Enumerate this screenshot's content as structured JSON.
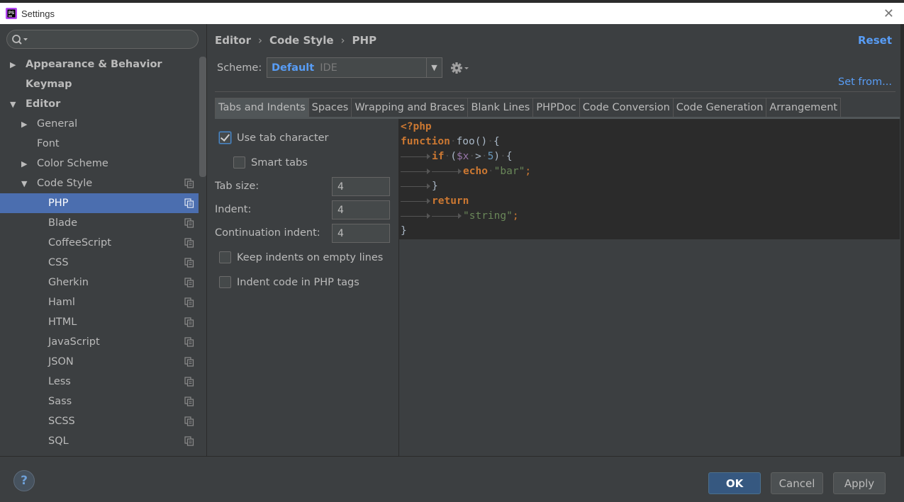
{
  "window": {
    "title": "Settings",
    "close_glyph": "✕",
    "app_icon": "phpstorm-icon"
  },
  "sidebar": {
    "search_placeholder": "",
    "items": [
      {
        "label": "Appearance & Behavior",
        "arrow": "▶",
        "level": 0,
        "bold": true
      },
      {
        "label": "Keymap",
        "arrow": "",
        "level": 0,
        "bold": true
      },
      {
        "label": "Editor",
        "arrow": "▼",
        "level": 0,
        "bold": true
      },
      {
        "label": "General",
        "arrow": "▶",
        "level": 1
      },
      {
        "label": "Font",
        "arrow": "",
        "level": 1
      },
      {
        "label": "Color Scheme",
        "arrow": "▶",
        "level": 1
      },
      {
        "label": "Code Style",
        "arrow": "▼",
        "level": 1,
        "icon": true
      },
      {
        "label": "PHP",
        "arrow": "",
        "level": 2,
        "icon": true,
        "selected": true
      },
      {
        "label": "Blade",
        "arrow": "",
        "level": 2,
        "icon": true
      },
      {
        "label": "CoffeeScript",
        "arrow": "",
        "level": 2,
        "icon": true
      },
      {
        "label": "CSS",
        "arrow": "",
        "level": 2,
        "icon": true
      },
      {
        "label": "Gherkin",
        "arrow": "",
        "level": 2,
        "icon": true
      },
      {
        "label": "Haml",
        "arrow": "",
        "level": 2,
        "icon": true
      },
      {
        "label": "HTML",
        "arrow": "",
        "level": 2,
        "icon": true
      },
      {
        "label": "JavaScript",
        "arrow": "",
        "level": 2,
        "icon": true
      },
      {
        "label": "JSON",
        "arrow": "",
        "level": 2,
        "icon": true
      },
      {
        "label": "Less",
        "arrow": "",
        "level": 2,
        "icon": true
      },
      {
        "label": "Sass",
        "arrow": "",
        "level": 2,
        "icon": true
      },
      {
        "label": "SCSS",
        "arrow": "",
        "level": 2,
        "icon": true
      },
      {
        "label": "SQL",
        "arrow": "",
        "level": 2,
        "icon": true
      }
    ]
  },
  "breadcrumb": {
    "items": [
      "Editor",
      "Code Style",
      "PHP"
    ],
    "separator": "›"
  },
  "reset_label": "Reset",
  "scheme": {
    "label": "Scheme:",
    "name": "Default",
    "sub": "IDE",
    "drop_glyph": "▼"
  },
  "set_from_label": "Set from...",
  "tabs": [
    {
      "label": "Tabs and Indents",
      "active": true
    },
    {
      "label": "Spaces"
    },
    {
      "label": "Wrapping and Braces"
    },
    {
      "label": "Blank Lines"
    },
    {
      "label": "PHPDoc"
    },
    {
      "label": "Code Conversion"
    },
    {
      "label": "Code Generation"
    },
    {
      "label": "Arrangement"
    }
  ],
  "options": {
    "use_tab_character": {
      "label": "Use tab character",
      "checked": true
    },
    "smart_tabs": {
      "label": "Smart tabs",
      "checked": false
    },
    "tab_size": {
      "label": "Tab size:",
      "value": "4"
    },
    "indent": {
      "label": "Indent:",
      "value": "4"
    },
    "continuation_indent": {
      "label": "Continuation indent:",
      "value": "4"
    },
    "keep_indents": {
      "label": "Keep indents on empty lines",
      "checked": false
    },
    "indent_php_tags": {
      "label": "Indent code in PHP tags",
      "checked": false
    }
  },
  "code": {
    "open_tag": "<?php",
    "kw_function": "function",
    "fn_name": "foo",
    "parens": "()",
    "brace_open": "{",
    "kw_if": "if",
    "cond_open": "(",
    "var": "$x",
    "op": ">",
    "num": "5",
    "cond_close": ")",
    "kw_echo": "echo",
    "str_bar": "\"bar\"",
    "semi": ";",
    "brace_close": "}",
    "kw_return": "return",
    "str_string": "\"string\""
  },
  "buttons": {
    "help": "?",
    "ok": "OK",
    "cancel": "Cancel",
    "apply": "Apply"
  },
  "colors": {
    "accent": "#589df6",
    "selection": "#4b6eaf",
    "editor_bg": "#2b2b2b",
    "panel_bg": "#3c3f41"
  }
}
